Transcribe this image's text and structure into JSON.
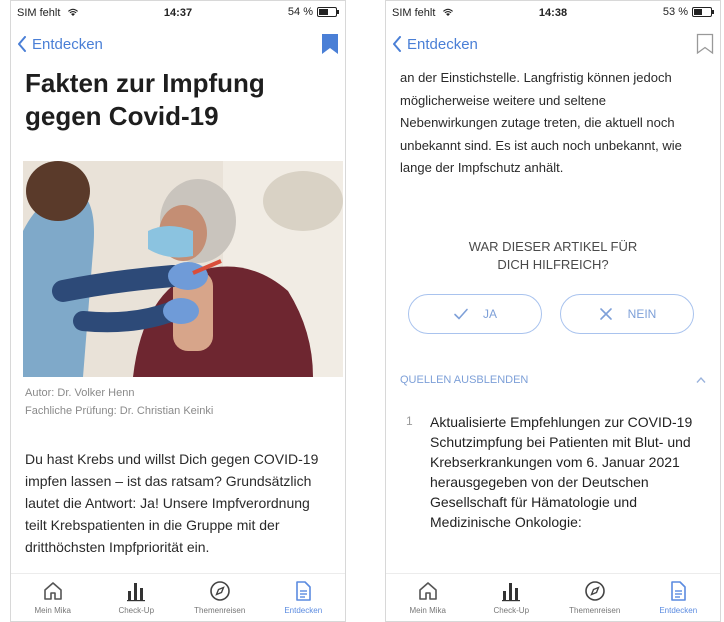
{
  "colors": {
    "accent": "#4a7fd6",
    "accent_light": "#a9c3ee",
    "text": "#222222",
    "muted": "#8a8a8a"
  },
  "left_screen": {
    "status": {
      "carrier": "SIM fehlt",
      "time": "14:37",
      "battery": "54 %",
      "battery_level": 0.54
    },
    "nav": {
      "back_label": "Entdecken",
      "bookmark_state": "filled"
    },
    "title": "Fakten zur Impfung gegen Covid-19",
    "author": "Autor: Dr. Volker Henn",
    "reviewer": "Fachliche Prüfung: Dr. Christian Keinki",
    "intro": "Du hast Krebs und willst Dich gegen COVID-19 impfen lassen – ist das ratsam? Grundsätzlich lautet die Antwort: Ja! Unsere Impfverordnung teilt Krebspatienten in die Gruppe mit der dritthöchsten Impfpriorität ein."
  },
  "right_screen": {
    "status": {
      "carrier": "SIM fehlt",
      "time": "14:38",
      "battery": "53 %",
      "battery_level": 0.53
    },
    "nav": {
      "back_label": "Entdecken",
      "bookmark_state": "outline"
    },
    "article_text": "an der Einstichstelle. Langfristig können jedoch möglicherweise weitere und seltene Nebenwirkungen zutage treten, die aktuell noch unbekannt sind. Es ist auch noch unbekannt, wie lange der Impfschutz anhält.",
    "feedback_question_line1": "WAR DIESER ARTIKEL FÜR",
    "feedback_question_line2": "DICH HILFREICH?",
    "yes_label": "JA",
    "no_label": "NEIN",
    "sources_toggle": "QUELLEN AUSBLENDEN",
    "sources": [
      {
        "number": "1",
        "text": "Aktualisierte Empfehlungen zur COVID-19 Schutzimpfung bei Patienten mit Blut- und Krebserkrankungen vom 6. Januar 2021 herausgegeben von der Deutschen Gesellschaft für Hämatologie und Medizinische Onkologie:"
      }
    ]
  },
  "tabbar": {
    "items": [
      {
        "label": "Mein Mika",
        "icon": "home-icon"
      },
      {
        "label": "Check-Up",
        "icon": "bar-chart-icon"
      },
      {
        "label": "Themenreisen",
        "icon": "compass-icon"
      },
      {
        "label": "Entdecken",
        "icon": "document-icon",
        "active": true
      }
    ]
  }
}
